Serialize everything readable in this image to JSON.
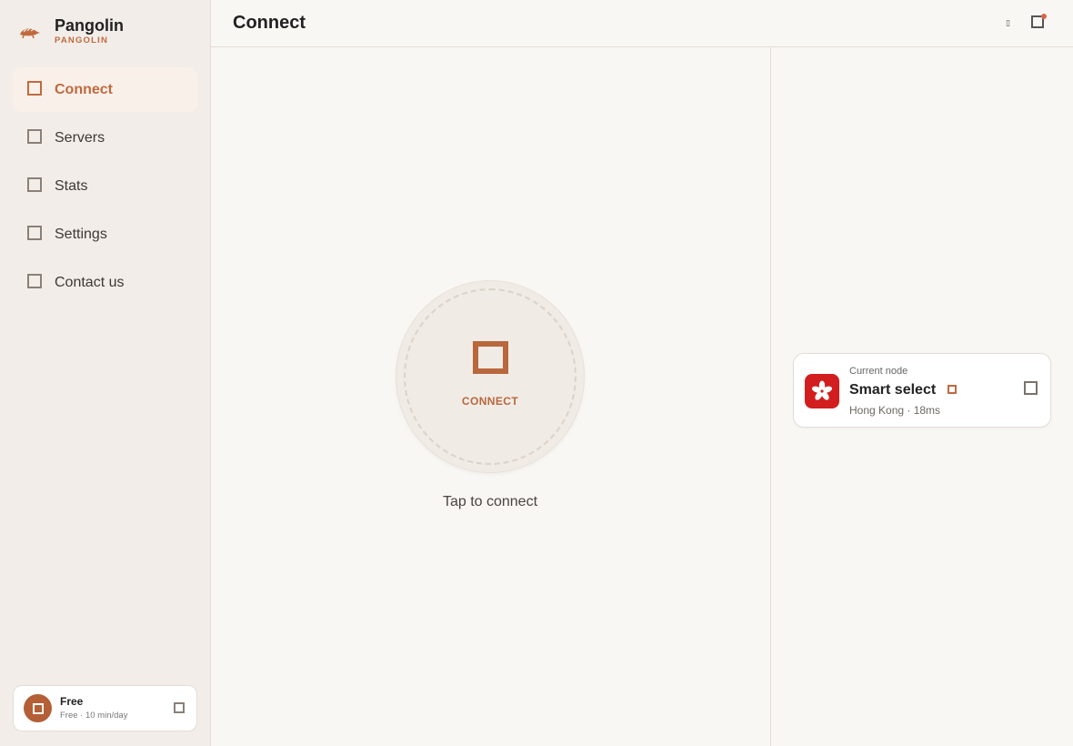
{
  "brand": {
    "name": "Pangolin",
    "subtitle": "PANGOLIN"
  },
  "sidebar": {
    "items": [
      {
        "label": "Connect",
        "icon": "connect-icon",
        "active": true
      },
      {
        "label": "Servers",
        "icon": "servers-icon",
        "active": false
      },
      {
        "label": "Stats",
        "icon": "stats-icon",
        "active": false
      },
      {
        "label": "Settings",
        "icon": "settings-icon",
        "active": false
      },
      {
        "label": "Contact us",
        "icon": "contact-icon",
        "active": false
      }
    ]
  },
  "plan": {
    "title": "Free",
    "subtitle": "Free · 10 min/day"
  },
  "header": {
    "title": "Connect",
    "action_glyph": "▯"
  },
  "connect": {
    "button_label": "CONNECT",
    "hint": "Tap to connect"
  },
  "node": {
    "caption": "Current node",
    "name": "Smart select",
    "meta": "Hong Kong · 18ms",
    "flag": "hong-kong-flag"
  },
  "colors": {
    "accent": "#c06a3e",
    "sidebar_bg": "#f2ede8",
    "page_bg": "#f9f7f4",
    "active_nav_bg": "#faf0ea",
    "flag_red": "#d21e1e",
    "notification": "#d9664a"
  }
}
